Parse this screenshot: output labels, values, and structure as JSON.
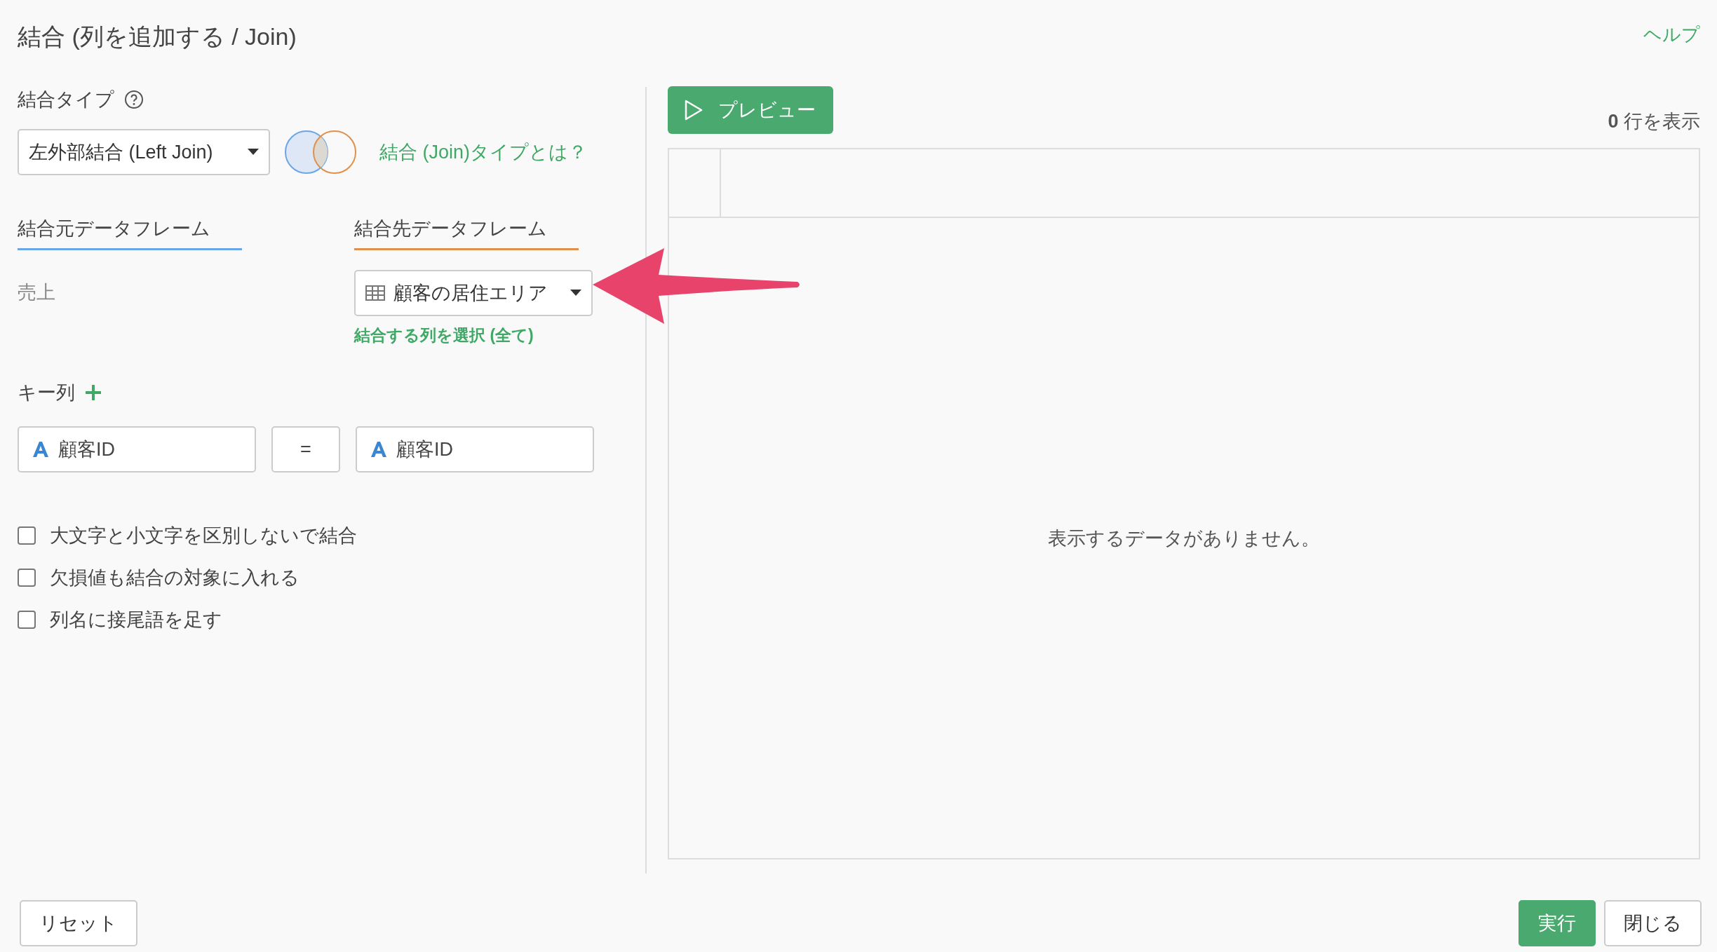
{
  "title": "結合 (列を追加する / Join)",
  "help_link": "ヘルプ",
  "join_type": {
    "label": "結合タイプ",
    "value": "左外部結合 (Left Join)",
    "info_link": "結合 (Join)タイプとは？"
  },
  "frame_tabs": [
    {
      "label": "結合元データフレーム",
      "color": "#6aa5e8"
    },
    {
      "label": "結合先データフレーム",
      "color": "#e0904a"
    }
  ],
  "source": {
    "name": "売上"
  },
  "target": {
    "value": "顧客の居住エリア",
    "columns_link": "結合する列を選択 (全て)"
  },
  "key_columns": {
    "label": "キー列",
    "pairs": [
      {
        "left": "顧客ID",
        "operator": "=",
        "right": "顧客ID"
      }
    ]
  },
  "options": [
    {
      "label": "大文字と小文字を区別しないで結合",
      "checked": false
    },
    {
      "label": "欠損値も結合の対象に入れる",
      "checked": false
    },
    {
      "label": "列名に接尾語を足す",
      "checked": false
    }
  ],
  "preview": {
    "button": "プレビュー",
    "row_count": "**0** 行を表示",
    "empty_message": "表示するデータがありません。"
  },
  "footer": {
    "left_buttons": [
      {
        "label": "リセット",
        "kind": "default"
      }
    ],
    "right_buttons": [
      {
        "label": "実行",
        "kind": "primary"
      },
      {
        "label": "閉じる",
        "kind": "default"
      }
    ]
  }
}
